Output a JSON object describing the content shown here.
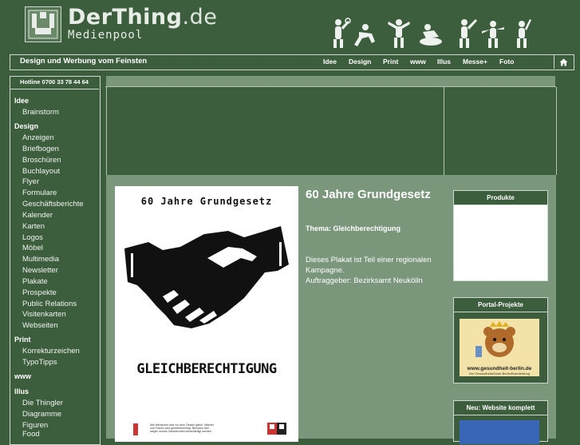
{
  "header": {
    "brand_main": "DerThing",
    "brand_tld": ".de",
    "subtitle": "Medienpool"
  },
  "nav": {
    "tagline": "Design und Werbung vom Feinsten",
    "items": [
      "Idee",
      "Design",
      "Print",
      "www",
      "Illus",
      "Messe+",
      "Foto"
    ]
  },
  "sidebar": {
    "hotline": "Hotline 0700 33 78 44 64",
    "categories": [
      {
        "label": "Idee",
        "items": [
          "Brainstorm"
        ]
      },
      {
        "label": "Design",
        "items": [
          "Anzeigen",
          "Briefbogen",
          "Broschüren",
          "Buchlayout",
          "Flyer",
          "Formulare",
          "Geschäftsberichte",
          "Kalender",
          "Karten",
          "Logos",
          "Möbel",
          "Multimedia",
          "Newsletter",
          "Plakate",
          "Prospekte",
          "Public Relations",
          "Visitenkarten",
          "Webseiten"
        ]
      },
      {
        "label": "Print",
        "items": [
          "Korrekturzeichen",
          "TypoTipps"
        ]
      },
      {
        "label": "www",
        "items": []
      },
      {
        "label": "Illus",
        "items": [
          "Die Thingler",
          "Diagramme",
          "Figuren",
          "Food"
        ]
      }
    ]
  },
  "poster": {
    "title": "60 Jahre Grundgesetz",
    "word": "GLEICHBERECHTIGUNG",
    "small_text": "Alle Menschen sind vor dem Gesetz gleich. Männer und Frauen sind gleichberechtigt. Niemand darf wegen seines Geschlechtes benachteiligt werden."
  },
  "article": {
    "title": "60 Jahre Grundgesetz",
    "theme": "Thema: Gleichberechtigung",
    "description": "Dieses Plakat ist Teil einer regionalen Kampagne.",
    "client": "Auftraggeber: Bezirksamt Neukölln"
  },
  "right_boxes": {
    "produkte": "Produkte",
    "portal": "Portal-Projekte",
    "portal_url": "www.gesundheit-berlin.de",
    "portal_caption": "Der GesundheitsGuide Berlin/Brandenburg",
    "website": "Neu: Website komplett"
  },
  "colors": {
    "background": "#3c5e3d",
    "panel": "#7a967b",
    "border": "#cfd8cf"
  },
  "icons": [
    "logo-icon",
    "home-icon",
    "handshake-icon",
    "bear-icon"
  ]
}
